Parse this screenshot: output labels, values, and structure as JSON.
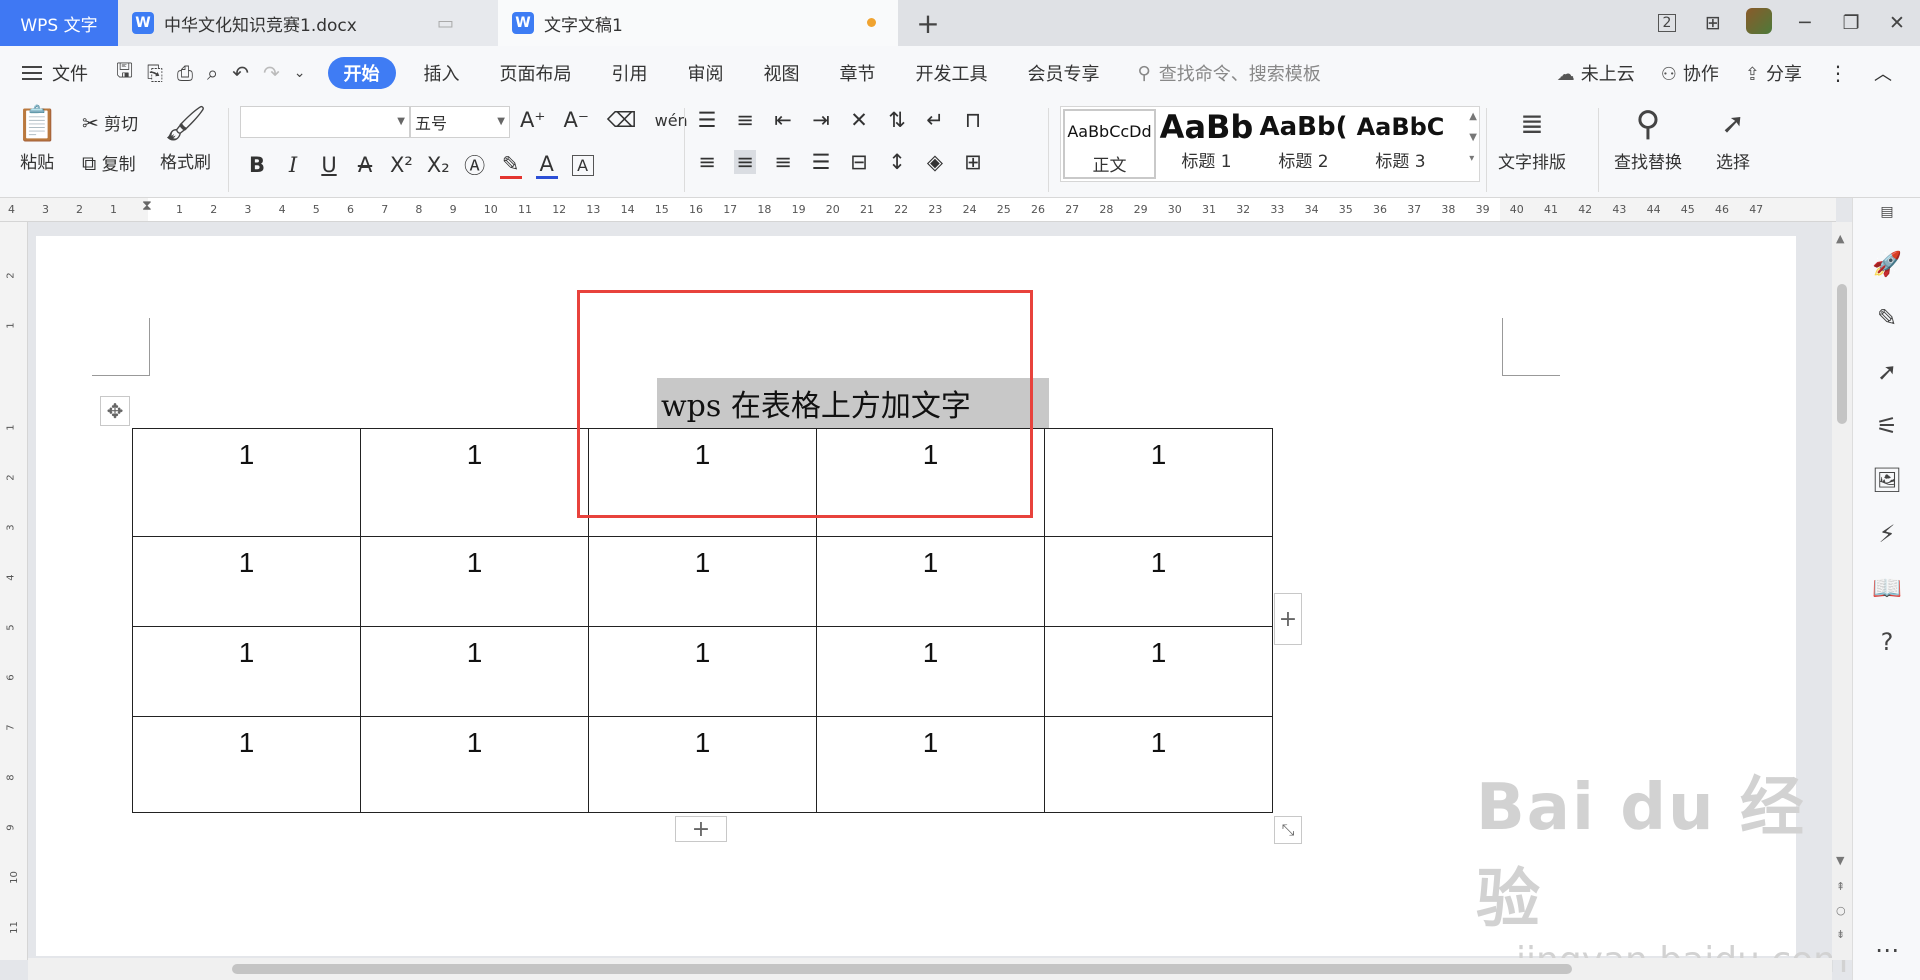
{
  "tabs": {
    "app": "WPS 文字",
    "doc1": "中华文化知识竞赛1.docx",
    "doc2": "文字文稿1",
    "new_tab": "+",
    "page_indicator": "2"
  },
  "menu": {
    "file": "文件",
    "items": [
      "开始",
      "插入",
      "页面布局",
      "引用",
      "审阅",
      "视图",
      "章节",
      "开发工具",
      "会员专享"
    ],
    "search_placeholder": "查找命令、搜索模板",
    "cloud": "未上云",
    "collab": "协作",
    "share": "分享"
  },
  "ribbon": {
    "paste": "粘贴",
    "cut": "剪切",
    "copy": "复制",
    "format_painter": "格式刷",
    "font_name": "",
    "font_size": "五号",
    "pinyin_label": "wén",
    "styles": [
      {
        "preview": "AaBbCcDd",
        "name": "正文"
      },
      {
        "preview": "AaBb",
        "name": "标题 1"
      },
      {
        "preview": "AaBb(",
        "name": "标题 2"
      },
      {
        "preview": "AaBbC",
        "name": "标题 3"
      }
    ],
    "text_layout": "文字排版",
    "find_replace": "查找替换",
    "select": "选择"
  },
  "ruler": {
    "h_left": [
      "4",
      "3",
      "2",
      "1"
    ],
    "h_right": [
      "1",
      "2",
      "3",
      "4",
      "5",
      "6",
      "7",
      "8",
      "9",
      "10",
      "11",
      "12",
      "13",
      "14",
      "15",
      "16",
      "17",
      "18",
      "19",
      "20",
      "21",
      "22",
      "23",
      "24",
      "25",
      "26",
      "27",
      "28",
      "29",
      "30",
      "31",
      "32",
      "33",
      "34",
      "35",
      "36",
      "37",
      "38",
      "39",
      "40",
      "41",
      "42",
      "43",
      "44",
      "45",
      "46",
      "47"
    ],
    "v_top": [
      "2",
      "1"
    ],
    "v_bottom": [
      "1",
      "2",
      "3",
      "4",
      "5",
      "6",
      "7",
      "8",
      "9",
      "10",
      "11"
    ]
  },
  "document": {
    "heading": "wps 在表格上方加文字",
    "table": [
      [
        "1",
        "1",
        "1",
        "1",
        "1"
      ],
      [
        "1",
        "1",
        "1",
        "1",
        "1"
      ],
      [
        "1",
        "1",
        "1",
        "1",
        "1"
      ],
      [
        "1",
        "1",
        "1",
        "1",
        "1"
      ]
    ]
  },
  "watermark": {
    "line1": "Bai du 经验",
    "line2": "jingyan.baidu.com"
  },
  "colors": {
    "accent": "#3f7cf4",
    "highlight_box": "#e8423c",
    "selection": "#c8c8c8"
  }
}
